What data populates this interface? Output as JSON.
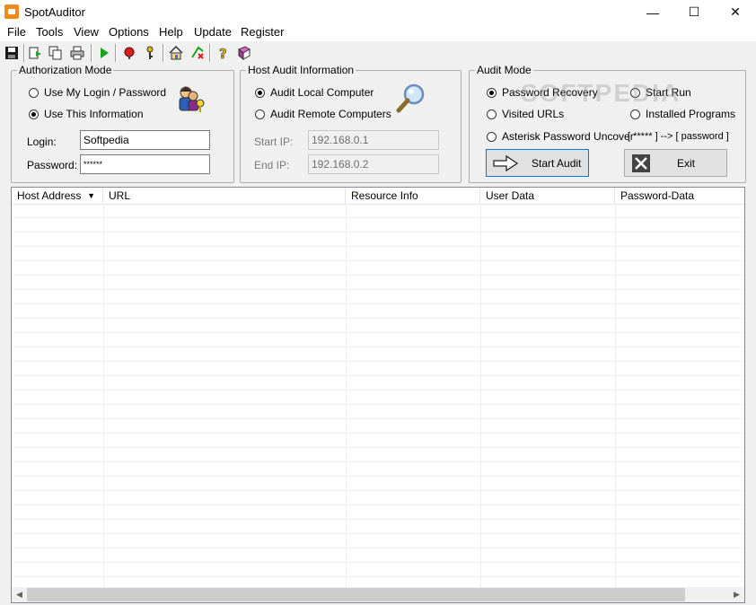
{
  "window": {
    "title": "SpotAuditor",
    "minimize": "—",
    "maximize": "☐",
    "close": "✕"
  },
  "menu": [
    "File",
    "Tools",
    "View",
    "Options",
    "Help",
    "Update",
    "Register"
  ],
  "authorization": {
    "title": "Authorization Mode",
    "option_my_login": "Use My Login / Password",
    "option_this_info": "Use This Information",
    "login_label": "Login:",
    "login_value": "Softpedia",
    "password_label": "Password:",
    "password_value": "******"
  },
  "host_audit": {
    "title": "Host Audit Information",
    "option_local": "Audit Local Computer",
    "option_remote": "Audit Remote Computers",
    "start_ip_label": "Start IP:",
    "start_ip_value": "192.168.0.1",
    "end_ip_label": "End IP:",
    "end_ip_value": "192.168.0.2"
  },
  "audit_mode": {
    "title": "Audit Mode",
    "password_recovery": "Password Recovery",
    "start_run": "Start Run",
    "visited_urls": "Visited URLs",
    "installed_programs": "Installed Programs",
    "asterisk_uncover": "Asterisk Password Uncover",
    "asterisk_hint": "[ ***** ] --> [ password ]",
    "start_audit": "Start Audit",
    "exit": "Exit"
  },
  "table": {
    "columns": [
      "Host Address",
      "URL",
      "Resource Info",
      "User Data",
      "Password-Data"
    ]
  },
  "watermark": "SOFTPEDIA"
}
